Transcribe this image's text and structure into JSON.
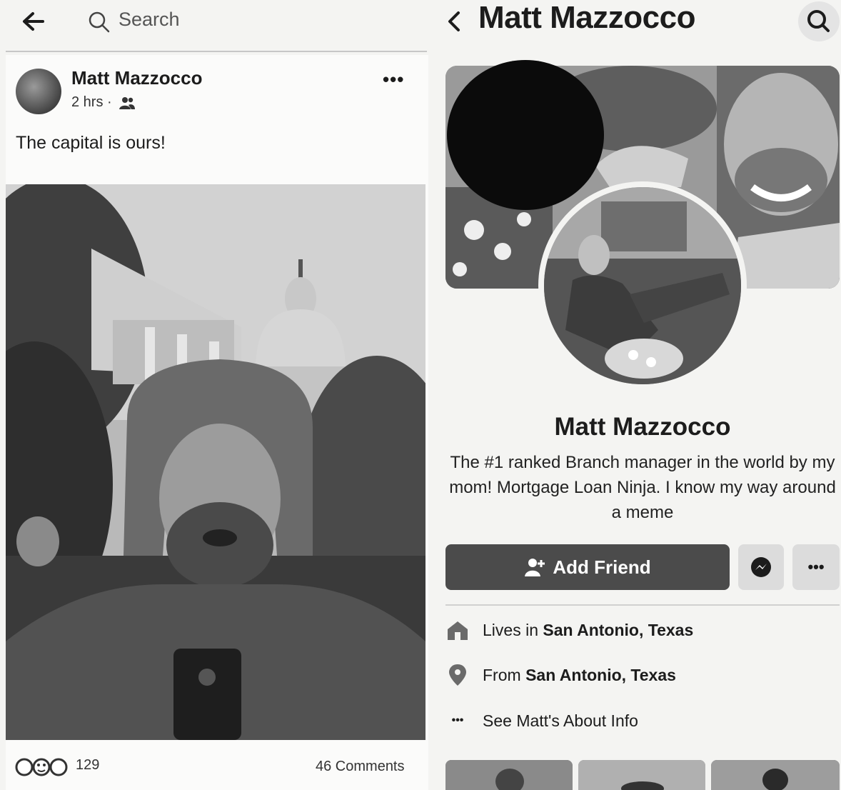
{
  "left_panel": {
    "search_placeholder": "Search",
    "post": {
      "author": "Matt Mazzocco",
      "time": "2 hrs ·",
      "text": "The capital is ours!",
      "more": "•••",
      "reaction_count": "129",
      "comments": "46 Comments"
    }
  },
  "right_panel": {
    "header_title": "Matt Mazzocco",
    "profile_name": "Matt Mazzocco",
    "bio": "The #1 ranked Branch manager in the world by my mom! Mortgage Loan Ninja. I know my way around a meme",
    "add_friend": "Add Friend",
    "more": "•••",
    "details": [
      {
        "prefix": "Lives in ",
        "value": "San Antonio, Texas",
        "icon": "home-icon"
      },
      {
        "prefix": "From ",
        "value": "San Antonio, Texas",
        "icon": "location-pin-icon"
      },
      {
        "prefix": "",
        "value": "See Matt's About Info",
        "icon": "more-dots-icon",
        "dots": "•••"
      }
    ]
  },
  "colors": {
    "background": "#f4f4f2",
    "primary_button": "#4b4b4b",
    "secondary_button": "#dcdcdc"
  }
}
